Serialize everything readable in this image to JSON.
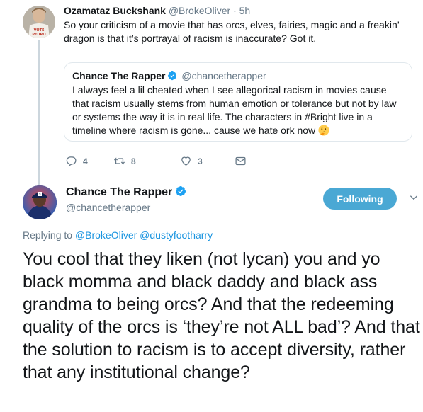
{
  "tweet1": {
    "name": "Ozamataz Buckshank",
    "handle": "@BrokeOliver",
    "separator": "·",
    "time": "5h",
    "text": "So your criticism of a movie that has orcs, elves, fairies, magic and a freakin’ dragon is that it’s portrayal of racism is inaccurate? Got it."
  },
  "quote": {
    "name": "Chance The Rapper",
    "handle": "@chancetherapper",
    "text": "I always feel a lil cheated when I see allegorical racism in movies cause that racism usually stems from human emotion or tolerance but not by law or systems the way it is in real life. The characters in #Bright live in a timeline where racism is gone... cause we hate ork now",
    "emoji": "thinking-face"
  },
  "actions": {
    "replies": "4",
    "retweets": "8",
    "likes": "3"
  },
  "main": {
    "name": "Chance The Rapper",
    "handle": "@chancetherapper",
    "follow_label": "Following",
    "replying_prefix": "Replying to",
    "mention1": "@BrokeOliver",
    "mention2": "@dustyfootharry",
    "text": "You cool that they liken (not lycan) you and yo black momma and black daddy and black ass grandma to being orcs? And that the redeeming quality of the orcs is ‘they’re not ALL bad’? And that the solution to racism is to accept diversity, rather that any institutional change?"
  },
  "colors": {
    "accent": "#1b95e0",
    "follow_button": "#4aa8d4",
    "secondary_text": "#657786",
    "border": "#e1e8ed"
  }
}
